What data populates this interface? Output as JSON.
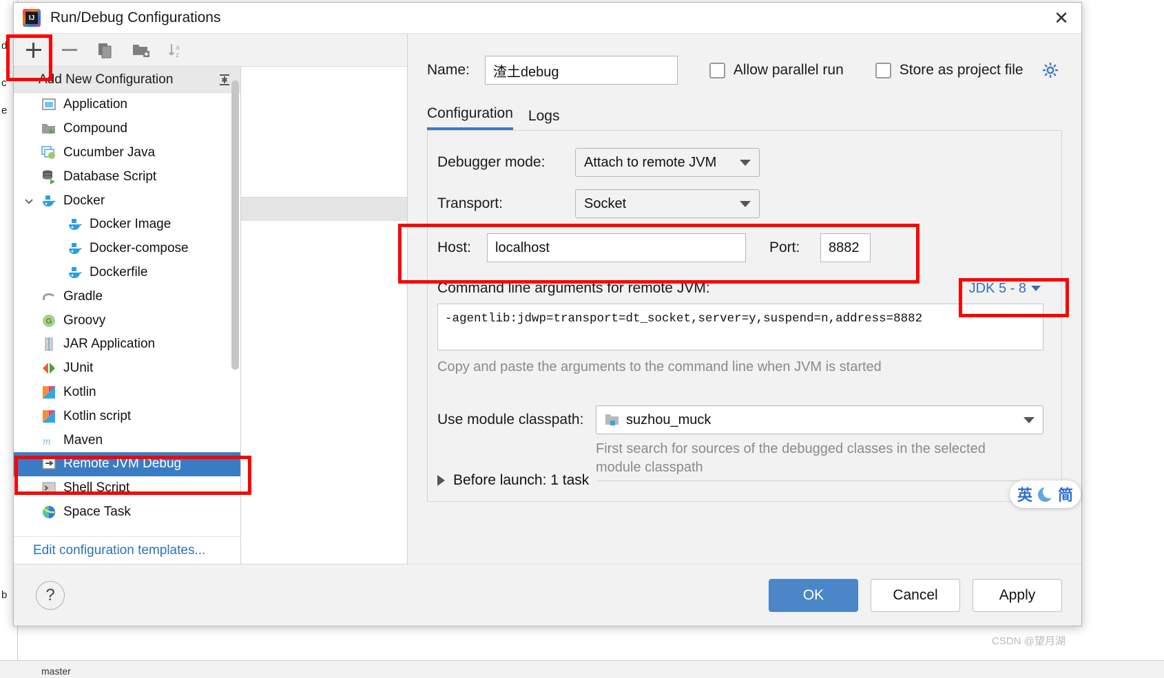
{
  "window": {
    "title": "Run/Debug Configurations",
    "logo_icon": "intellij-idea-logo",
    "close_icon": "close-icon"
  },
  "toolbar": {
    "add_icon": "plus-icon",
    "remove_icon": "minus-icon",
    "copy_icon": "copy-icon",
    "folder_icon": "new-folder-icon",
    "sort_icon": "sort-alphabetically-icon"
  },
  "tree": {
    "header": "Add New Configuration",
    "collapse_icon": "collapse-all-icon",
    "items": [
      {
        "label": "Application",
        "icon": "application-icon",
        "indent": 0,
        "selected": false,
        "expander": ""
      },
      {
        "label": "Compound",
        "icon": "compound-icon",
        "indent": 0,
        "selected": false,
        "expander": ""
      },
      {
        "label": "Cucumber Java",
        "icon": "cucumber-java-icon",
        "indent": 0,
        "selected": false,
        "expander": ""
      },
      {
        "label": "Database Script",
        "icon": "database-script-icon",
        "indent": 0,
        "selected": false,
        "expander": ""
      },
      {
        "label": "Docker",
        "icon": "docker-icon",
        "indent": 0,
        "selected": false,
        "expander": "chevron-down-icon"
      },
      {
        "label": "Docker Image",
        "icon": "docker-icon",
        "indent": 1,
        "selected": false,
        "expander": ""
      },
      {
        "label": "Docker-compose",
        "icon": "docker-icon",
        "indent": 1,
        "selected": false,
        "expander": ""
      },
      {
        "label": "Dockerfile",
        "icon": "docker-icon",
        "indent": 1,
        "selected": false,
        "expander": ""
      },
      {
        "label": "Gradle",
        "icon": "gradle-icon",
        "indent": 0,
        "selected": false,
        "expander": ""
      },
      {
        "label": "Groovy",
        "icon": "groovy-icon",
        "indent": 0,
        "selected": false,
        "expander": ""
      },
      {
        "label": "JAR Application",
        "icon": "jar-application-icon",
        "indent": 0,
        "selected": false,
        "expander": ""
      },
      {
        "label": "JUnit",
        "icon": "junit-icon",
        "indent": 0,
        "selected": false,
        "expander": ""
      },
      {
        "label": "Kotlin",
        "icon": "kotlin-icon",
        "indent": 0,
        "selected": false,
        "expander": ""
      },
      {
        "label": "Kotlin script",
        "icon": "kotlin-script-icon",
        "indent": 0,
        "selected": false,
        "expander": ""
      },
      {
        "label": "Maven",
        "icon": "maven-icon",
        "indent": 0,
        "selected": false,
        "expander": ""
      },
      {
        "label": "Remote JVM Debug",
        "icon": "remote-jvm-debug-icon",
        "indent": 0,
        "selected": true,
        "expander": ""
      },
      {
        "label": "Shell Script",
        "icon": "shell-script-icon",
        "indent": 0,
        "selected": false,
        "expander": ""
      },
      {
        "label": "Space Task",
        "icon": "space-task-icon",
        "indent": 0,
        "selected": false,
        "expander": ""
      }
    ],
    "edit_templates_link": "Edit configuration templates..."
  },
  "form": {
    "name_label": "Name:",
    "name_value": "渣土debug",
    "allow_parallel_run_label": "Allow parallel run",
    "allow_parallel_run_checked": false,
    "store_as_project_file_label": "Store as project file",
    "store_as_project_file_checked": false,
    "gear_icon": "gear-icon",
    "tabs": [
      {
        "label": "Configuration",
        "active": true
      },
      {
        "label": "Logs",
        "active": false
      }
    ],
    "debugger_mode_label": "Debugger mode:",
    "debugger_mode_value": "Attach to remote JVM",
    "transport_label": "Transport:",
    "transport_value": "Socket",
    "host_label": "Host:",
    "host_value": "localhost",
    "port_label": "Port:",
    "port_value": "8882",
    "args_label": "Command line arguments for remote JVM:",
    "args_value": "-agentlib:jdwp=transport=dt_socket,server=y,suspend=n,address=8882",
    "args_hint": "Copy and paste the arguments to the command line when JVM is started",
    "jdk_selector_label": "JDK 5 - 8",
    "module_classpath_label": "Use module classpath:",
    "module_classpath_value": "suzhou_muck",
    "module_classpath_icon": "module-folder-icon",
    "module_hint_line1": "First search for sources of the debugged classes in the selected",
    "module_hint_line2": "module classpath",
    "before_launch_label": "Before launch: 1 task",
    "before_launch_expander": "triangle-right-icon"
  },
  "footer": {
    "help_label": "?",
    "ok_label": "OK",
    "cancel_label": "Cancel",
    "apply_label": "Apply",
    "ok_color": "#4a86c8"
  },
  "annotations": {
    "color": "#ff0000",
    "boxes": [
      "add-button-highlight",
      "host-port-highlight",
      "jdk-selector-highlight",
      "remote-jvm-debug-highlight"
    ]
  },
  "overlay": {
    "ime_mode": "英",
    "ime_shape": "简",
    "ime_moon_icon": "moon-icon",
    "watermark": "CSDN @望月湖"
  },
  "background": {
    "left_letters": [
      "d",
      "c",
      "e",
      "b"
    ],
    "bottom_text": "master"
  }
}
